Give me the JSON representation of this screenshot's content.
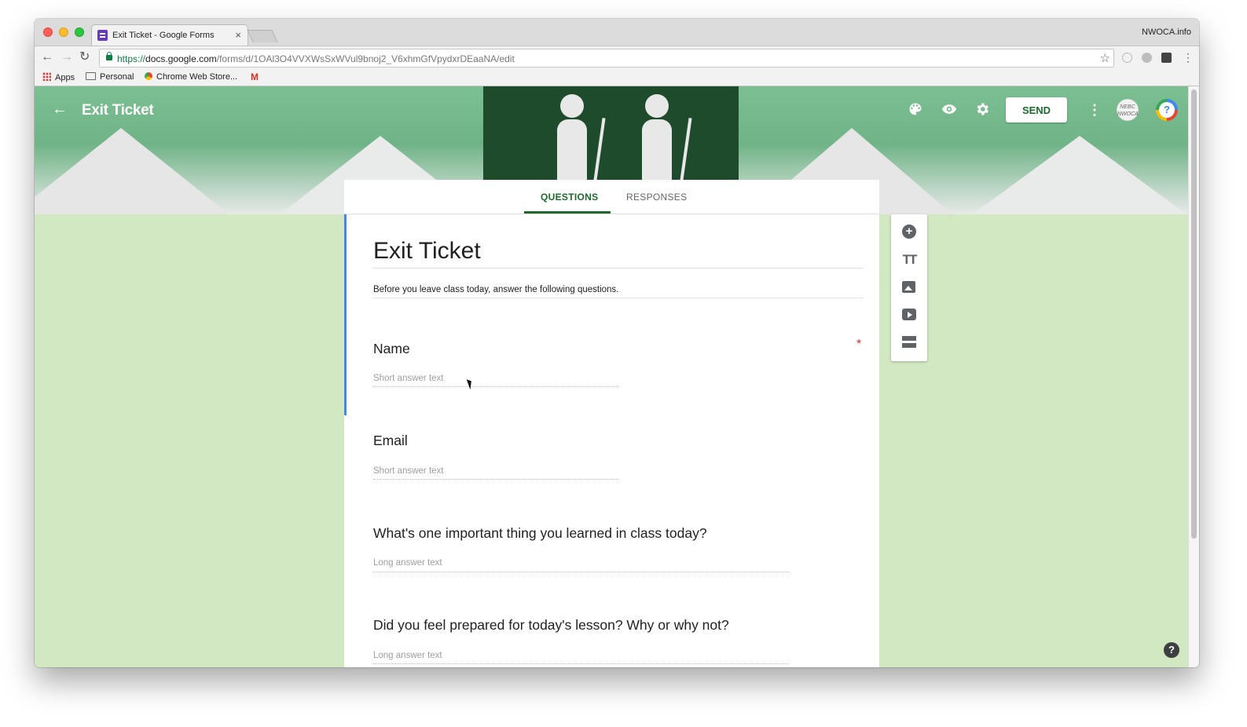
{
  "browser": {
    "tab_title": "Exit Ticket - Google Forms",
    "tab_close": "×",
    "profile_name": "NWOCA.info",
    "url_scheme": "https://",
    "url_host": "docs.google.com",
    "url_path": "/forms/d/1OAl3O4VVXWsSxWVul9bnoj2_V6xhmGfVpydxrDEaaNA/edit",
    "back_glyph": "←",
    "forward_glyph": "→",
    "reload_glyph": "↻",
    "star_glyph": "☆",
    "bookmarks": {
      "apps": "Apps",
      "personal": "Personal",
      "chrome_web_store": "Chrome Web Store...",
      "gmail": "M"
    }
  },
  "header": {
    "back_glyph": "←",
    "title": "Exit Ticket",
    "send_label": "SEND",
    "avatar_text": "NEBC NWOCA",
    "help_glyph": "?",
    "icons": [
      "palette-icon",
      "eye-icon",
      "gear-icon",
      "more-vert-icon"
    ],
    "colors": {
      "theme_green": "#1b6b2b",
      "background": "#d2e8c2",
      "focus_blue": "#4285f4",
      "required_red": "#d93025"
    }
  },
  "tabs": {
    "questions": "QUESTIONS",
    "responses": "RESPONSES",
    "active": "QUESTIONS"
  },
  "form": {
    "title": "Exit Ticket",
    "description": "Before you leave class today, answer the following questions.",
    "required_mark": "*",
    "questions": [
      {
        "title": "Name",
        "answer_hint": "Short answer text",
        "required": true
      },
      {
        "title": "Email",
        "answer_hint": "Short answer text",
        "required": false
      },
      {
        "title": "What's one important thing you learned in class today?",
        "answer_hint": "Long answer text",
        "required": false
      },
      {
        "title": "Did you feel prepared for today's lesson?  Why or why not?",
        "answer_hint": "Long answer text",
        "required": false
      }
    ]
  },
  "side_tools": {
    "add_glyph": "+",
    "title_glyph": "TT",
    "icons": [
      "add-question-icon",
      "add-title-icon",
      "add-image-icon",
      "add-video-icon",
      "add-section-icon"
    ]
  },
  "floating_help": "?"
}
